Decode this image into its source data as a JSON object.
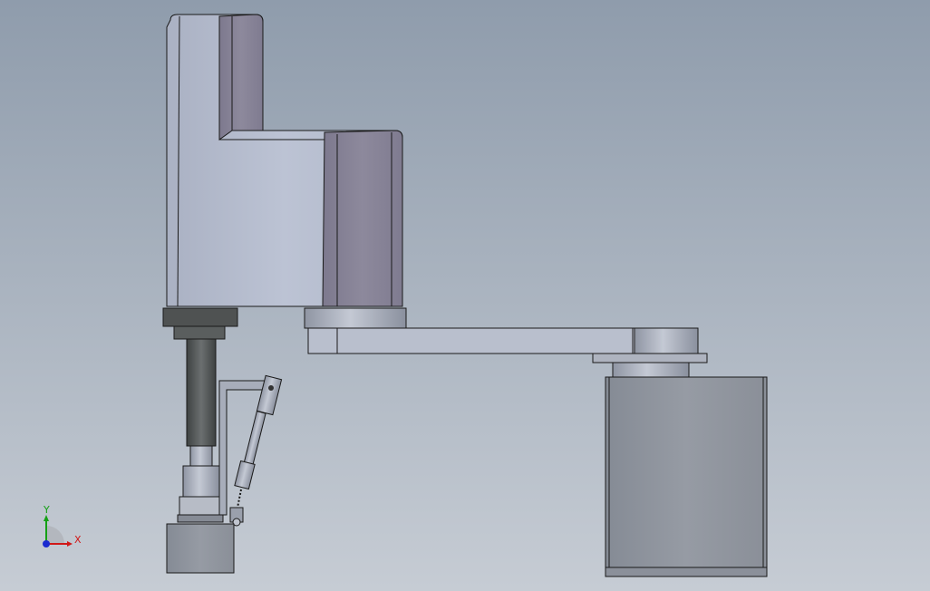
{
  "viewport": {
    "background_top": "#8f9cac",
    "background_bottom": "#c6ccd4"
  },
  "model": {
    "body_color": "#b4bbcd",
    "side_face_color": "#898599",
    "dark_part_color": "#4f5252",
    "base_color": "#8e939c",
    "edge_color": "#1a1a1a"
  },
  "triad": {
    "x_label": "X",
    "y_label": "Y",
    "x_color": "#d01818",
    "y_color": "#15a015",
    "z_color": "#1a2ad0"
  }
}
